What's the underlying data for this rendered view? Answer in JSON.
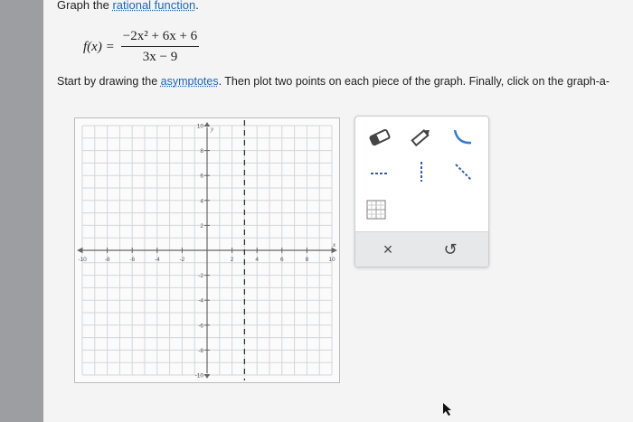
{
  "title": {
    "prefix": "Graph the ",
    "link": "rational function",
    "suffix": "."
  },
  "function": {
    "lhs": "f(x) =",
    "numerator": "−2x² + 6x + 6",
    "denominator": "3x − 9"
  },
  "instructions": {
    "before": "Start by drawing the ",
    "link": "asymptotes",
    "after": ". Then plot two points on each piece of the graph. Finally, click on the graph-a-"
  },
  "graph": {
    "x_range": [
      -10,
      10
    ],
    "y_range": [
      -10,
      10
    ],
    "x_ticks": [
      "-10",
      "-8",
      "-6",
      "-4",
      "-2",
      "2",
      "4",
      "6",
      "8",
      "10"
    ],
    "y_ticks": [
      "10",
      "8",
      "6",
      "4",
      "2",
      "-2",
      "-4",
      "-6",
      "-8",
      "-10"
    ],
    "x_axis_label": "x",
    "y_axis_label": "y",
    "vertical_asymptote_x": 3,
    "grid": true
  },
  "tools": {
    "items": [
      "eraser-icon",
      "pencil-icon",
      "curve-icon",
      "horizontal-dashed-line-icon",
      "vertical-dashed-line-icon",
      "slant-dashed-line-icon",
      "fraction-grid-icon"
    ],
    "clear_label": "×",
    "undo_label": "↺"
  },
  "colors": {
    "link": "#1f66b4",
    "grid": "#d3d6d9",
    "axis": "#666666"
  }
}
